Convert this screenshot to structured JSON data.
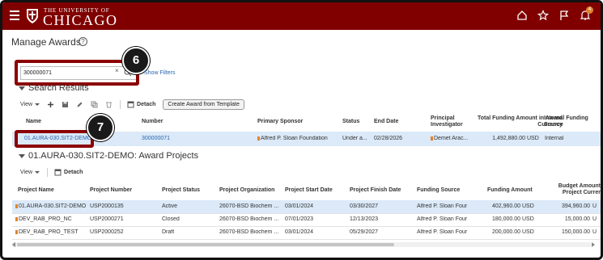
{
  "header": {
    "university_small": "THE UNIVERSITY OF",
    "university_big": "CHICAGO",
    "notification_count": "4",
    "brand_color": "#800000"
  },
  "page": {
    "title": "Manage Awards",
    "help": "?"
  },
  "search": {
    "value": "300000071",
    "clear": "×",
    "show_filters": "Show Filters"
  },
  "callouts": {
    "search_step": "6",
    "result_step": "7"
  },
  "search_results": {
    "title": "Search Results",
    "toolbar": {
      "view": "View",
      "detach": "Detach",
      "create_template": "Create Award from Template"
    },
    "columns": {
      "name": "Name",
      "number": "Number",
      "primary_sponsor": "Primary Sponsor",
      "status": "Status",
      "end_date": "End Date",
      "principal_investigator": "Principal Investigator",
      "total_funding": "Total Funding Amount in Award Currency",
      "internal_funding": "Internal Funding Source"
    },
    "row": {
      "name": "01.AURA-030.SIT2-DEMO",
      "number": "300000071",
      "primary_sponsor": "Alfred P. Sloan Foundation",
      "status": "Under a...",
      "end_date": "02/28/2026",
      "principal_investigator": "Demet Arac...",
      "total_funding": "1,492,880.00",
      "currency": "USD",
      "internal_funding": "Internal"
    }
  },
  "award_projects": {
    "title": "01.AURA-030.SIT2-DEMO: Award Projects",
    "toolbar": {
      "view": "View",
      "detach": "Detach"
    },
    "columns": {
      "project_name": "Project Name",
      "project_number": "Project Number",
      "project_status": "Project Status",
      "project_organization": "Project Organization",
      "start_date": "Project Start Date",
      "finish_date": "Project Finish Date",
      "funding_source": "Funding Source",
      "funding_amount": "Funding Amount",
      "budget_amount_line1": "Budget Amount",
      "budget_amount_line2": "Project Currer"
    },
    "rows": [
      {
        "name": "01.AURA-030.SIT2-DEMO",
        "number": "USP2000135",
        "status": "Active",
        "organization": "26070-BSD Biochem ...",
        "start": "03/01/2024",
        "finish": "03/30/2027",
        "source": "Alfred P. Sloan Four",
        "amount": "402,960.00",
        "currency": "USD",
        "budget": "394,960.00",
        "budget_currency": "U"
      },
      {
        "name": "DEV_RAB_PRO_NC",
        "number": "USP2000271",
        "status": "Closed",
        "organization": "26070-BSD Biochem ...",
        "start": "07/01/2023",
        "finish": "12/13/2023",
        "source": "Alfred P. Sloan Four",
        "amount": "180,000.00",
        "currency": "USD",
        "budget": "15,000.00",
        "budget_currency": "U"
      },
      {
        "name": "DEV_RAB_PRO_TEST",
        "number": "USP2000252",
        "status": "Draft",
        "organization": "26070-BSD Biochem ...",
        "start": "03/01/2024",
        "finish": "05/29/2027",
        "source": "Alfred P. Sloan Four",
        "amount": "200,000.00",
        "currency": "USD",
        "budget": "150,000.00",
        "budget_currency": "U"
      }
    ]
  }
}
